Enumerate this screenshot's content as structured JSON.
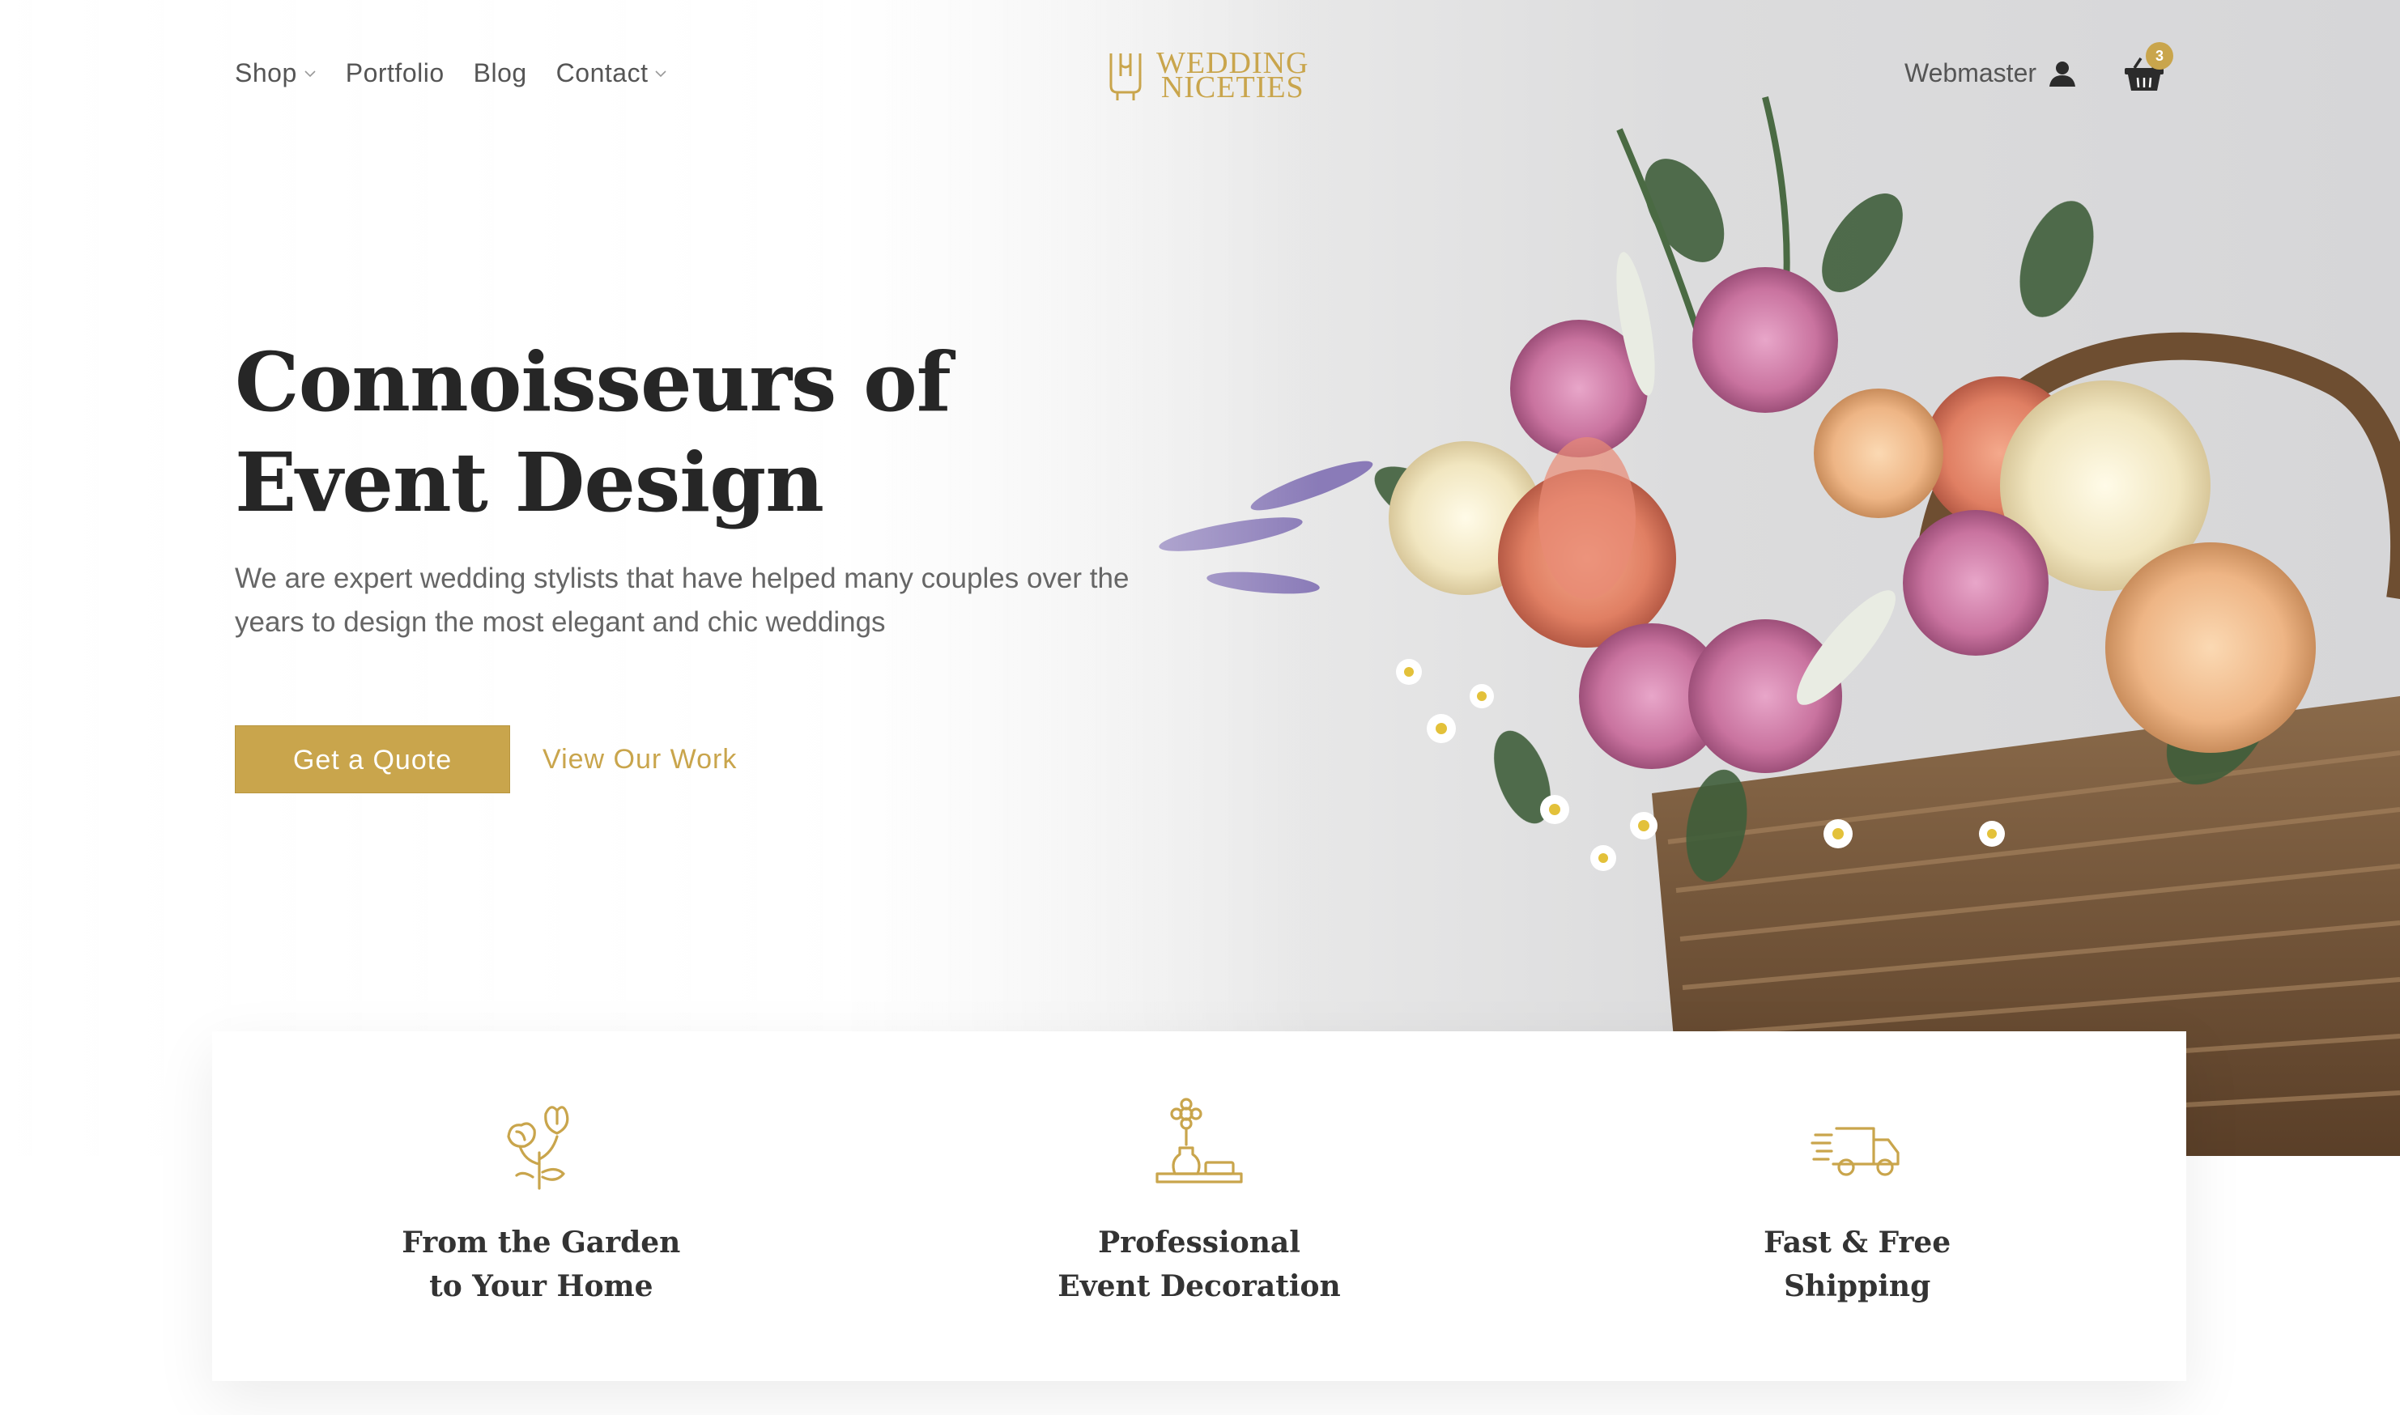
{
  "header": {
    "nav": [
      {
        "label": "Shop",
        "has_dropdown": true
      },
      {
        "label": "Portfolio",
        "has_dropdown": false
      },
      {
        "label": "Blog",
        "has_dropdown": false
      },
      {
        "label": "Contact",
        "has_dropdown": true
      }
    ],
    "logo": {
      "line1": "WEDDING",
      "line2": "NICETIES",
      "icon": "wn-monogram-icon"
    },
    "account_label": "Webmaster",
    "account_icon": "user-icon",
    "cart_icon": "basket-icon",
    "cart_count": "3"
  },
  "hero": {
    "title": "Connoisseurs of Event Design",
    "subtitle": "We are expert wedding stylists that have helped many couples over the years to design the most elegant and chic weddings",
    "primary_button": "Get a Quote",
    "secondary_button": "View Our Work"
  },
  "features": [
    {
      "icon": "flowers-icon",
      "title": "From the Garden\nto Your Home"
    },
    {
      "icon": "vase-decoration-icon",
      "title": "Professional\nEvent Decoration"
    },
    {
      "icon": "delivery-truck-icon",
      "title": "Fast & Free\nShipping"
    }
  ],
  "colors": {
    "accent": "#c9a54c",
    "text_dark": "#262626",
    "text_muted": "#666666"
  }
}
